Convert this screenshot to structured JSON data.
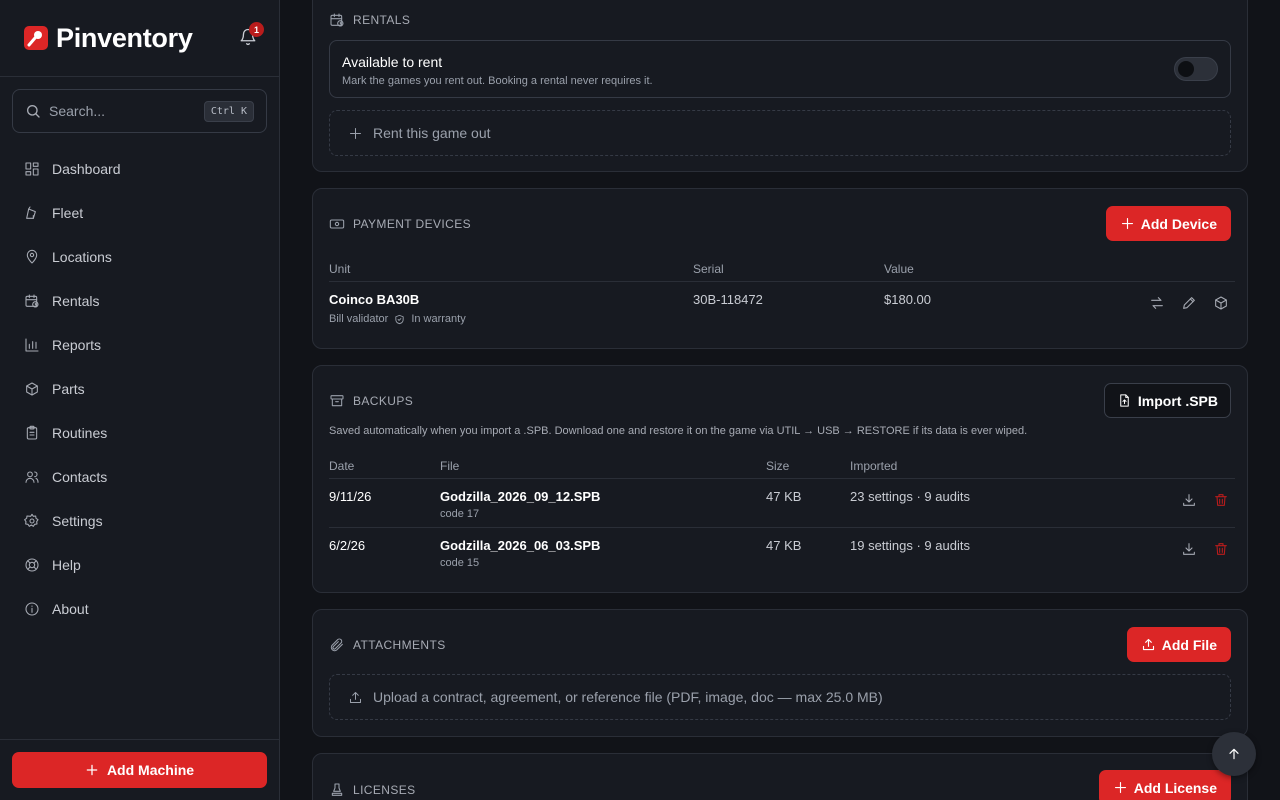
{
  "app": {
    "name": "Pinventory",
    "notifications": "1"
  },
  "search": {
    "placeholder": "Search...",
    "shortcut": "Ctrl K"
  },
  "nav": [
    {
      "label": "Dashboard",
      "icon": "dashboard-icon"
    },
    {
      "label": "Fleet",
      "icon": "fleet-icon"
    },
    {
      "label": "Locations",
      "icon": "map-pin-icon"
    },
    {
      "label": "Rentals",
      "icon": "calendar-clock-icon"
    },
    {
      "label": "Reports",
      "icon": "bar-chart-icon"
    },
    {
      "label": "Parts",
      "icon": "package-icon"
    },
    {
      "label": "Routines",
      "icon": "clipboard-icon"
    },
    {
      "label": "Contacts",
      "icon": "users-icon"
    },
    {
      "label": "Settings",
      "icon": "gear-icon"
    },
    {
      "label": "Help",
      "icon": "lifebuoy-icon"
    },
    {
      "label": "About",
      "icon": "info-icon"
    }
  ],
  "sidebar_footer": {
    "add_machine": "Add Machine"
  },
  "rentals": {
    "title": "RENTALS",
    "available_label": "Available to rent",
    "available_desc": "Mark the games you rent out. Booking a rental never requires it.",
    "available_on": false,
    "rent_out": "Rent this game out"
  },
  "payment_devices": {
    "title": "PAYMENT DEVICES",
    "add_button": "Add Device",
    "columns": [
      "Unit",
      "Serial",
      "Value"
    ],
    "rows": [
      {
        "unit": "Coinco BA30B",
        "type": "Bill validator",
        "warranty": "In warranty",
        "serial": "30B-118472",
        "value": "$180.00"
      }
    ]
  },
  "backups": {
    "title": "BACKUPS",
    "import_button": "Import .SPB",
    "description": "Saved automatically when you import a .SPB. Download one and restore it on the game via UTIL → USB → RESTORE if its data is ever wiped.",
    "columns": [
      "Date",
      "File",
      "Size",
      "Imported"
    ],
    "rows": [
      {
        "date": "9/11/26",
        "file": "Godzilla_2026_09_12.SPB",
        "code": "code 17",
        "size": "47 KB",
        "imported": "23 settings · 9 audits"
      },
      {
        "date": "6/2/26",
        "file": "Godzilla_2026_06_03.SPB",
        "code": "code 15",
        "size": "47 KB",
        "imported": "19 settings · 9 audits"
      }
    ]
  },
  "attachments": {
    "title": "ATTACHMENTS",
    "add_button": "Add File",
    "upload_hint": "Upload a contract, agreement, or reference file (PDF, image, doc — max 25.0 MB)"
  },
  "licenses": {
    "title": "LICENSES",
    "add_button": "Add License"
  },
  "colors": {
    "accent": "#dc2626",
    "background": "#111318",
    "surface": "#171a21"
  }
}
